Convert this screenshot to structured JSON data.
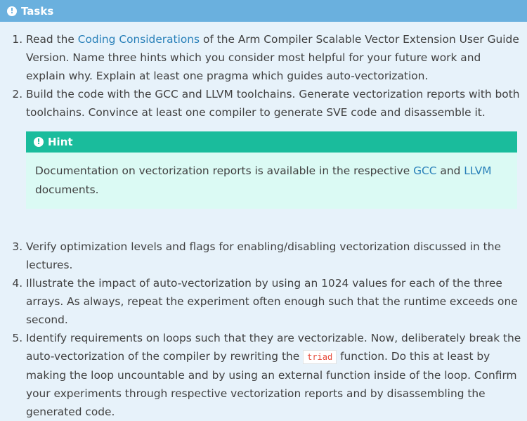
{
  "tasks_box": {
    "title": "Tasks",
    "items": [
      {
        "pre": "Read the ",
        "link": "Coding Considerations",
        "post": " of the Arm Compiler Scalable Vector Extension User Guide Version. Name three hints which you consider most helpful for your future work and explain why. Explain at least one pragma which guides auto-vectorization."
      },
      {
        "text": "Build the code with the GCC and LLVM toolchains. Generate vectorization reports with both toolchains. Convince at least one compiler to generate SVE code and disassemble it."
      },
      {
        "text": "Verify optimization levels and flags for enabling/disabling vectorization discussed in the lectures."
      },
      {
        "text": "Illustrate the impact of auto-vectorization by using an 1024 values for each of the three arrays. As always, repeat the experiment often enough such that the runtime exceeds one second."
      },
      {
        "pre": "Identify requirements on loops such that they are vectorizable. Now, deliberately break the auto-vectorization of the compiler by rewriting the ",
        "code": "triad",
        "post": " function. Do this at least by making the loop uncountable and by using an external function inside of the loop. Confirm your experiments through respective vectorization reports and by disassembling the generated code."
      }
    ]
  },
  "hint_box": {
    "title": "Hint",
    "pre": "Documentation on vectorization reports is available in the respective ",
    "link1": "GCC",
    "mid": " and ",
    "link2": "LLVM",
    "post": " documents."
  },
  "colors": {
    "tasks_header": "#6ab0de",
    "tasks_background": "#e7f2fa",
    "hint_header": "#1abc9c",
    "hint_background": "#dbfaf4",
    "link": "#2980b9",
    "code": "#e74c3c"
  },
  "icons": {
    "tasks_title_icon": "exclamation-circle-icon",
    "hint_title_icon": "exclamation-circle-icon"
  }
}
